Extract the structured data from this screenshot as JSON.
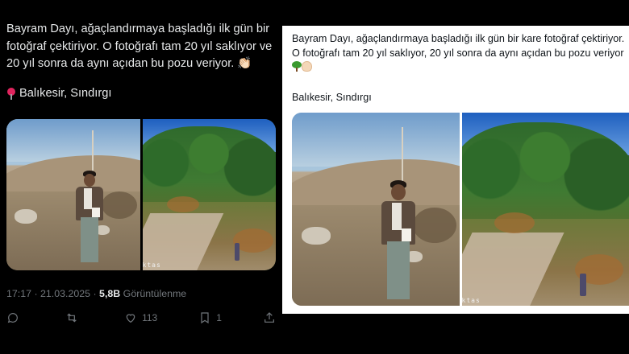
{
  "dark_tweet": {
    "text": "Bayram Dayı, ağaçlandırmaya başladığı ilk gün bir fotoğraf çektiriyor. O fotoğrafı tam 20 yıl saklıyor ve 20 yıl sonra da aynı açıdan bu pozu veriyor. 👏🏻",
    "location": "Balıkesir, Sındırgı",
    "timestamp": "17:17 · 21.03.2025 · ",
    "views_count": "5,8B",
    "views_label": " Görüntülenme",
    "watermark": "ktas",
    "actions": {
      "reply_count": "",
      "retweet_count": "",
      "like_count": "113",
      "bookmark_count": "1"
    }
  },
  "light_tweet": {
    "text": "Bayram Dayı, ağaçlandırmaya başladığı ilk gün bir kare fotoğraf çektiriyor. O fotoğrafı tam 20 yıl saklıyor, 20 yıl sonra da aynı açıdan bu pozu veriyor",
    "location": "Balıkesir, Sındırgı",
    "watermark": "ktas"
  },
  "colors": {
    "dark_bg": "#000000",
    "dark_text": "#e7e9ea",
    "muted": "#71767b",
    "light_bg": "#ffffff"
  }
}
